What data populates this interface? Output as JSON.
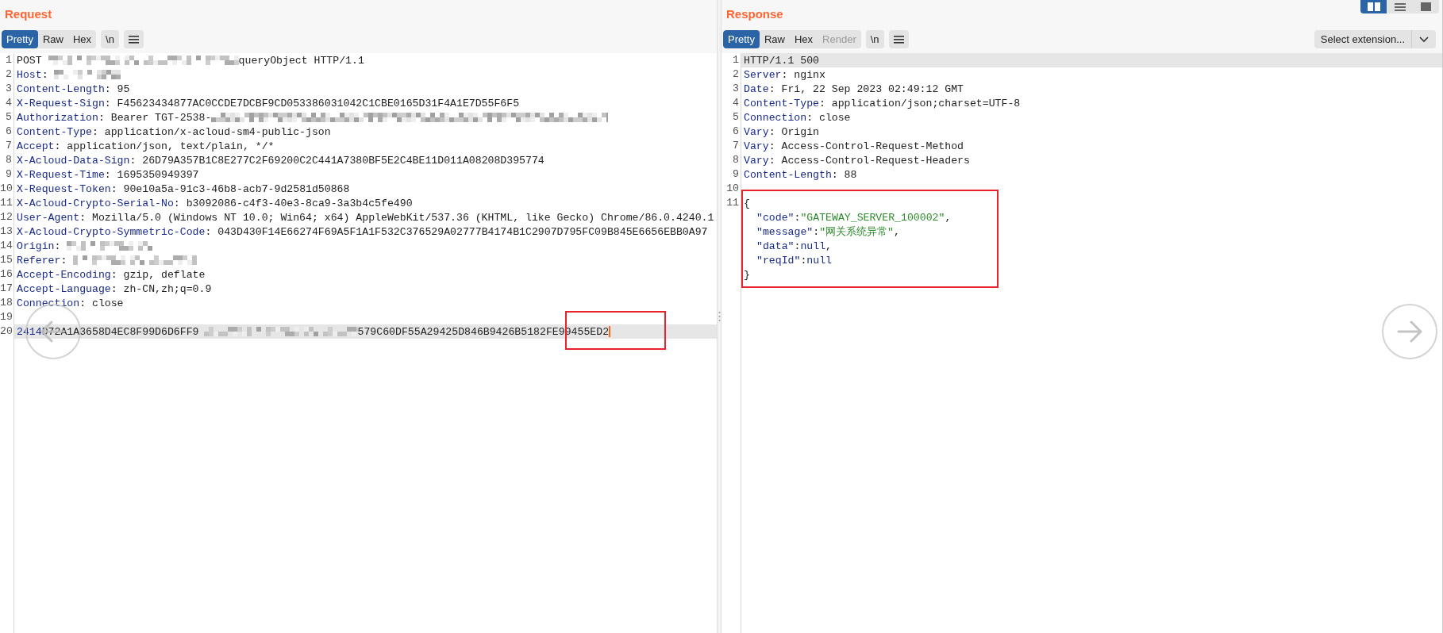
{
  "layout_buttons": [
    {
      "selected": true
    },
    {
      "selected": false
    },
    {
      "selected": false
    }
  ],
  "request": {
    "title": "Request",
    "tabs": [
      {
        "label": "Pretty",
        "selected": true,
        "disabled": false
      },
      {
        "label": "Raw",
        "selected": false,
        "disabled": false
      },
      {
        "label": "Hex",
        "selected": false,
        "disabled": false
      }
    ],
    "newline_button": "\\n",
    "lines": [
      {
        "number": "1",
        "current": false,
        "caret": false,
        "parts": [
          {
            "kind": "text",
            "text": "POST "
          },
          {
            "kind": "redacted"
          },
          {
            "kind": "text",
            "text": "queryObject HTTP/1.1"
          }
        ]
      },
      {
        "number": "2",
        "current": false,
        "caret": false,
        "parts": [
          {
            "kind": "name",
            "text": "Host"
          },
          {
            "kind": "text",
            "text": ": "
          },
          {
            "kind": "redacted"
          }
        ]
      },
      {
        "number": "3",
        "current": false,
        "caret": false,
        "parts": [
          {
            "kind": "name",
            "text": "Content-Length"
          },
          {
            "kind": "text",
            "text": ": 95"
          }
        ]
      },
      {
        "number": "4",
        "current": false,
        "caret": false,
        "parts": [
          {
            "kind": "name",
            "text": "X-Request-Sign"
          },
          {
            "kind": "text",
            "text": ": F45623434877AC0CCDE7DCBF9CD053386031042C1CBE0165D31F4A1E7D55F6F5"
          }
        ]
      },
      {
        "number": "5",
        "current": false,
        "caret": false,
        "parts": [
          {
            "kind": "name",
            "text": "Authorization"
          },
          {
            "kind": "text",
            "text": ": Bearer TGT-2538-"
          },
          {
            "kind": "redacted"
          }
        ]
      },
      {
        "number": "6",
        "current": false,
        "caret": false,
        "parts": [
          {
            "kind": "name",
            "text": "Content-Type"
          },
          {
            "kind": "text",
            "text": ": application/x-acloud-sm4-public-json"
          }
        ]
      },
      {
        "number": "7",
        "current": false,
        "caret": false,
        "parts": [
          {
            "kind": "name",
            "text": "Accept"
          },
          {
            "kind": "text",
            "text": ": application/json, text/plain, */*"
          }
        ]
      },
      {
        "number": "8",
        "current": false,
        "caret": false,
        "parts": [
          {
            "kind": "name",
            "text": "X-Acloud-Data-Sign"
          },
          {
            "kind": "text",
            "text": ": 26D79A357B1C8E277C2F69200C2C441A7380BF5E2C4BE11D011A08208D395774"
          }
        ]
      },
      {
        "number": "9",
        "current": false,
        "caret": false,
        "parts": [
          {
            "kind": "name",
            "text": "X-Request-Time"
          },
          {
            "kind": "text",
            "text": ": 1695350949397"
          }
        ]
      },
      {
        "number": "10",
        "current": false,
        "caret": false,
        "parts": [
          {
            "kind": "name",
            "text": "X-Request-Token"
          },
          {
            "kind": "text",
            "text": ": 90e10a5a-91c3-46b8-acb7-9d2581d50868"
          }
        ]
      },
      {
        "number": "11",
        "current": false,
        "caret": false,
        "parts": [
          {
            "kind": "name",
            "text": "X-Acloud-Crypto-Serial-No"
          },
          {
            "kind": "text",
            "text": ": b3092086-c4f3-40e3-8ca9-3a3b4c5fe490"
          }
        ]
      },
      {
        "number": "12",
        "current": false,
        "caret": false,
        "parts": [
          {
            "kind": "name",
            "text": "User-Agent"
          },
          {
            "kind": "text",
            "text": ": Mozilla/5.0 (Windows NT 10.0; Win64; x64) AppleWebKit/537.36 (KHTML, like Gecko) Chrome/86.0.4240.1"
          }
        ]
      },
      {
        "number": "13",
        "current": false,
        "caret": false,
        "parts": [
          {
            "kind": "name",
            "text": "X-Acloud-Crypto-Symmetric-Code"
          },
          {
            "kind": "text",
            "text": ": 043D430F14E66274F69A5F1A1F532C376529A02777B4174B1C2907D795FC09B845E6656EBB0A97"
          }
        ]
      },
      {
        "number": "14",
        "current": false,
        "caret": false,
        "parts": [
          {
            "kind": "name",
            "text": "Origin"
          },
          {
            "kind": "text",
            "text": ": "
          },
          {
            "kind": "redacted"
          }
        ]
      },
      {
        "number": "15",
        "current": false,
        "caret": false,
        "parts": [
          {
            "kind": "name",
            "text": "Referer"
          },
          {
            "kind": "text",
            "text": ": "
          },
          {
            "kind": "redacted"
          }
        ]
      },
      {
        "number": "16",
        "current": false,
        "caret": false,
        "parts": [
          {
            "kind": "name",
            "text": "Accept-Encoding"
          },
          {
            "kind": "text",
            "text": ": gzip, deflate"
          }
        ]
      },
      {
        "number": "17",
        "current": false,
        "caret": false,
        "parts": [
          {
            "kind": "name",
            "text": "Accept-Language"
          },
          {
            "kind": "text",
            "text": ": zh-CN,zh;q=0.9"
          }
        ]
      },
      {
        "number": "18",
        "current": false,
        "caret": false,
        "parts": [
          {
            "kind": "name",
            "text": "Connection"
          },
          {
            "kind": "text",
            "text": ": close"
          }
        ]
      },
      {
        "number": "19",
        "current": false,
        "caret": false
      },
      {
        "number": "20",
        "current": true,
        "caret": true,
        "parts": [
          {
            "kind": "name",
            "text": "2414"
          },
          {
            "kind": "text",
            "text": "D72A1A3658D4EC8F99D6D6FF9"
          },
          {
            "kind": "redacted"
          },
          {
            "kind": "text",
            "text": "579C60DF55A29425D846B9426B5182FE99455ED2"
          }
        ]
      }
    ]
  },
  "response": {
    "title": "Response",
    "tabs": [
      {
        "label": "Pretty",
        "selected": true,
        "disabled": false
      },
      {
        "label": "Raw",
        "selected": false,
        "disabled": false
      },
      {
        "label": "Hex",
        "selected": false,
        "disabled": false
      },
      {
        "label": "Render",
        "selected": false,
        "disabled": true
      }
    ],
    "newline_button": "\\n",
    "extension_select": "Select extension...",
    "lines": [
      {
        "number": "1",
        "current": true,
        "caret": false,
        "parts": [
          {
            "kind": "text",
            "text": "HTTP/1.1 500"
          }
        ]
      },
      {
        "number": "2",
        "current": false,
        "caret": false,
        "parts": [
          {
            "kind": "name",
            "text": "Server"
          },
          {
            "kind": "text",
            "text": ": nginx"
          }
        ]
      },
      {
        "number": "3",
        "current": false,
        "caret": false,
        "parts": [
          {
            "kind": "name",
            "text": "Date"
          },
          {
            "kind": "text",
            "text": ": Fri, 22 Sep 2023 02:49:12 GMT"
          }
        ]
      },
      {
        "number": "4",
        "current": false,
        "caret": false,
        "parts": [
          {
            "kind": "name",
            "text": "Content-Type"
          },
          {
            "kind": "text",
            "text": ": application/json;charset=UTF-8"
          }
        ]
      },
      {
        "number": "5",
        "current": false,
        "caret": false,
        "parts": [
          {
            "kind": "name",
            "text": "Connection"
          },
          {
            "kind": "text",
            "text": ": close"
          }
        ]
      },
      {
        "number": "6",
        "current": false,
        "caret": false,
        "parts": [
          {
            "kind": "name",
            "text": "Vary"
          },
          {
            "kind": "text",
            "text": ": Origin"
          }
        ]
      },
      {
        "number": "7",
        "current": false,
        "caret": false,
        "parts": [
          {
            "kind": "name",
            "text": "Vary"
          },
          {
            "kind": "text",
            "text": ": Access-Control-Request-Method"
          }
        ]
      },
      {
        "number": "8",
        "current": false,
        "caret": false,
        "parts": [
          {
            "kind": "name",
            "text": "Vary"
          },
          {
            "kind": "text",
            "text": ": Access-Control-Request-Headers"
          }
        ]
      },
      {
        "number": "9",
        "current": false,
        "caret": false,
        "parts": [
          {
            "kind": "name",
            "text": "Content-Length"
          },
          {
            "kind": "text",
            "text": ": 88"
          }
        ]
      },
      {
        "number": "10",
        "current": false,
        "caret": false
      },
      {
        "number": "11",
        "current": false,
        "caret": false,
        "parts": [
          {
            "kind": "text",
            "text": "{"
          }
        ],
        "children": [
          {
            "current": false,
            "caret": false,
            "parts": [
              {
                "kind": "name",
                "text": "\"code\""
              },
              {
                "kind": "text",
                "text": ":"
              },
              {
                "kind": "string",
                "text": "\"GATEWAY_SERVER_100002\""
              },
              {
                "kind": "text",
                "text": ","
              }
            ]
          },
          {
            "current": false,
            "caret": false,
            "parts": [
              {
                "kind": "name",
                "text": "\"message\""
              },
              {
                "kind": "text",
                "text": ":"
              },
              {
                "kind": "string",
                "text": "\"网关系统异常\""
              },
              {
                "kind": "text",
                "text": ","
              }
            ]
          },
          {
            "current": false,
            "caret": false,
            "parts": [
              {
                "kind": "name",
                "text": "\"data\""
              },
              {
                "kind": "text",
                "text": ":"
              },
              {
                "kind": "name",
                "text": "null"
              },
              {
                "kind": "text",
                "text": ","
              }
            ]
          },
          {
            "current": false,
            "caret": false,
            "parts": [
              {
                "kind": "name",
                "text": "\"reqId\""
              },
              {
                "kind": "text",
                "text": ":"
              },
              {
                "kind": "name",
                "text": "null"
              }
            ]
          }
        ]
      },
      {
        "current": false,
        "caret": false,
        "parts": [
          {
            "kind": "text",
            "text": "}"
          }
        ]
      }
    ]
  }
}
